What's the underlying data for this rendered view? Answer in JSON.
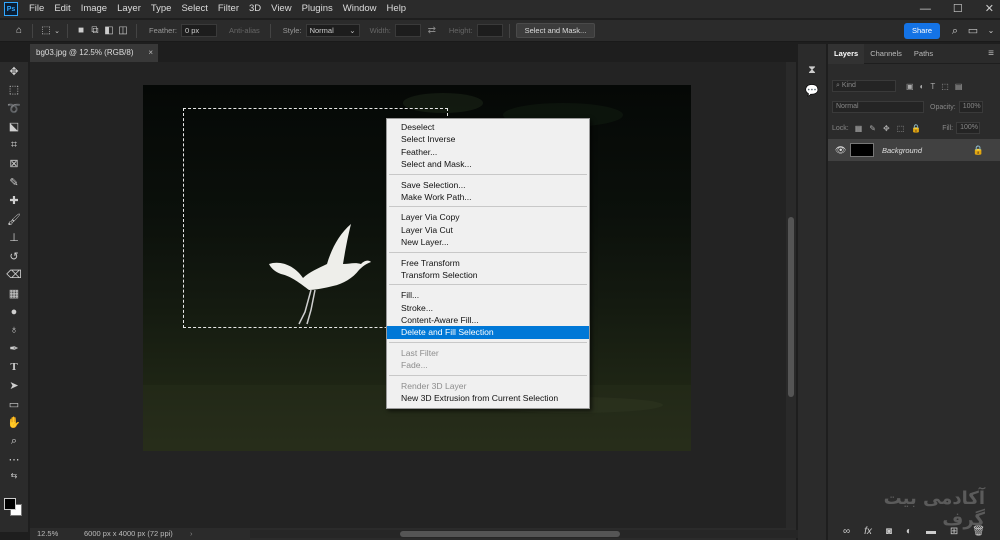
{
  "menubar": {
    "logo": "Ps",
    "items": [
      "File",
      "Edit",
      "Image",
      "Layer",
      "Type",
      "Select",
      "Filter",
      "3D",
      "View",
      "Plugins",
      "Window",
      "Help"
    ],
    "window_controls": [
      "—",
      "☐",
      "✕"
    ]
  },
  "options": {
    "feather_label": "Feather:",
    "feather_value": "0 px",
    "anti_alias_label": "Anti-alias",
    "style_label": "Style:",
    "style_value": "Normal",
    "width_label": "Width:",
    "height_label": "Height:",
    "select_mask_button": "Select and Mask...",
    "share_button": "Share"
  },
  "document": {
    "tab_title": "bg03.jpg @ 12.5% (RGB/8)",
    "close": "×"
  },
  "status": {
    "zoom": "12.5%",
    "dimensions": "6000 px x 4000 px (72 ppi)"
  },
  "context_menu": {
    "groups": [
      [
        {
          "label": "Deselect"
        },
        {
          "label": "Select Inverse"
        },
        {
          "label": "Feather..."
        },
        {
          "label": "Select and Mask..."
        }
      ],
      [
        {
          "label": "Save Selection..."
        },
        {
          "label": "Make Work Path..."
        }
      ],
      [
        {
          "label": "Layer Via Copy"
        },
        {
          "label": "Layer Via Cut"
        },
        {
          "label": "New Layer..."
        }
      ],
      [
        {
          "label": "Free Transform"
        },
        {
          "label": "Transform Selection"
        }
      ],
      [
        {
          "label": "Fill..."
        },
        {
          "label": "Stroke..."
        },
        {
          "label": "Content-Aware Fill..."
        },
        {
          "label": "Delete and Fill Selection",
          "highlighted": true
        }
      ],
      [
        {
          "label": "Last Filter",
          "disabled": true
        },
        {
          "label": "Fade...",
          "disabled": true
        }
      ],
      [
        {
          "label": "Render 3D Layer",
          "disabled": true
        },
        {
          "label": "New 3D Extrusion from Current Selection"
        }
      ]
    ]
  },
  "layers_panel": {
    "tabs": [
      "Layers",
      "Channels",
      "Paths"
    ],
    "kind_label": "Kind",
    "blend_mode": "Normal",
    "opacity_label": "Opacity:",
    "opacity_value": "100%",
    "lock_label": "Lock:",
    "fill_label": "Fill:",
    "fill_value": "100%",
    "layers": [
      {
        "name": "Background",
        "visible": true,
        "locked": true
      }
    ]
  },
  "watermark": "آکادمی بیت گرف",
  "colors": {
    "accent": "#1473e6",
    "menu_highlight": "#0078d7"
  }
}
